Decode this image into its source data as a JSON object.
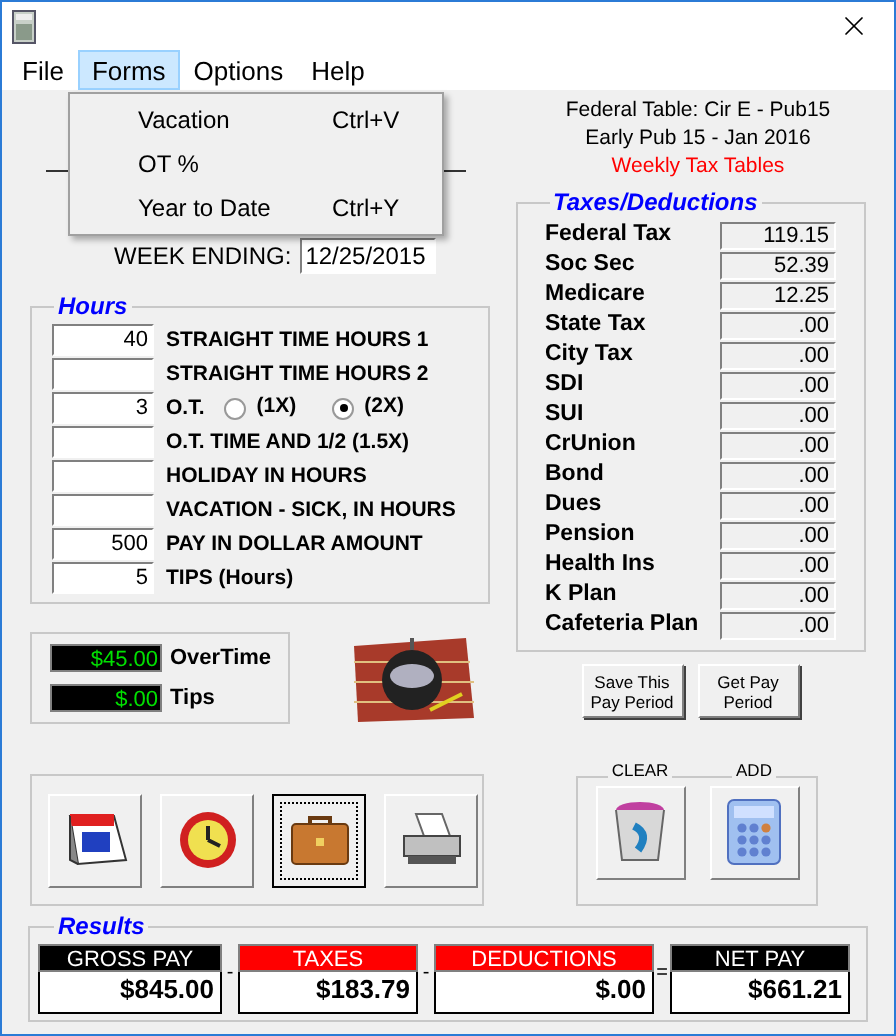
{
  "menu": [
    {
      "label": "File",
      "selected": false
    },
    {
      "label": "Forms",
      "selected": true
    },
    {
      "label": "Options",
      "selected": false
    },
    {
      "label": "Help",
      "selected": false
    }
  ],
  "dropdown": [
    {
      "label": "Vacation",
      "shortcut": "Ctrl+V"
    },
    {
      "label": "OT %"
    },
    {
      "label": "Year to Date",
      "shortcut": "Ctrl+Y"
    }
  ],
  "header": {
    "federal_table": "Federal Table: Cir E - Pub15",
    "publication": "Early Pub 15 - Jan 2016",
    "tax_tables": "Weekly Tax Tables"
  },
  "week_ending": {
    "label": "WEEK ENDING:",
    "value": "12/25/2015"
  },
  "hours": {
    "title": "Hours",
    "rows": [
      {
        "kind": "field",
        "entry": "40",
        "caption": "STRAIGHT TIME HOURS 1"
      },
      {
        "kind": "field",
        "caption": "STRAIGHT TIME HOURS 2"
      },
      {
        "kind": "ot",
        "entry": "3",
        "caption": "O.T.",
        "options": [
          {
            "label": "(1X)",
            "selected": false
          },
          {
            "label": "(2X)",
            "selected": true
          }
        ]
      },
      {
        "kind": "field",
        "caption": "O.T. TIME AND 1/2 (1.5X)"
      },
      {
        "kind": "field",
        "caption": "HOLIDAY IN HOURS"
      },
      {
        "kind": "field",
        "caption": "VACATION - SICK, IN HOURS"
      },
      {
        "kind": "field",
        "entry": "500",
        "caption": "PAY IN DOLLAR AMOUNT"
      },
      {
        "kind": "field",
        "entry": "5",
        "caption": "TIPS (Hours)"
      }
    ]
  },
  "displays": [
    {
      "value": "$45.00",
      "label": "OverTime"
    },
    {
      "value": "$.00",
      "label": "Tips"
    }
  ],
  "taxes": {
    "title": "Taxes/Deductions",
    "items": [
      {
        "label": "Federal Tax",
        "value": "119.15"
      },
      {
        "label": "Soc Sec",
        "value": "52.39"
      },
      {
        "label": "Medicare",
        "value": "12.25"
      },
      {
        "label": "State Tax",
        "value": ".00"
      },
      {
        "label": "City Tax",
        "value": ".00"
      },
      {
        "label": "SDI",
        "value": ".00"
      },
      {
        "label": "SUI",
        "value": ".00"
      },
      {
        "label": "CrUnion",
        "value": ".00"
      },
      {
        "label": "Bond",
        "value": ".00"
      },
      {
        "label": "Dues",
        "value": ".00"
      },
      {
        "label": "Pension",
        "value": ".00"
      },
      {
        "label": "Health Ins",
        "value": ".00"
      },
      {
        "label": "K Plan",
        "value": ".00"
      },
      {
        "label": "Cafeteria Plan",
        "value": ".00"
      }
    ]
  },
  "period_buttons": [
    "Save This Pay Period",
    "Get Pay Period"
  ],
  "tools": [
    {
      "kind": "calendar",
      "focused": false
    },
    {
      "kind": "clock",
      "focused": false
    },
    {
      "kind": "briefcase",
      "focused": true
    },
    {
      "kind": "printer",
      "focused": false
    }
  ],
  "actions": [
    {
      "kind": "clear",
      "label": "CLEAR"
    },
    {
      "kind": "add",
      "label": "ADD"
    }
  ],
  "results": {
    "title": "Results",
    "items": [
      {
        "label": "GROSS PAY",
        "value": "$845.00",
        "color": "#000000",
        "operator": "-"
      },
      {
        "label": "TAXES",
        "value": "$183.79",
        "color": "#ff0000",
        "operator": "-"
      },
      {
        "label": "DEDUCTIONS",
        "value": "$.00",
        "color": "#ff0000",
        "operator": "="
      },
      {
        "label": "NET PAY",
        "value": "$661.21",
        "color": "#000000"
      }
    ]
  }
}
